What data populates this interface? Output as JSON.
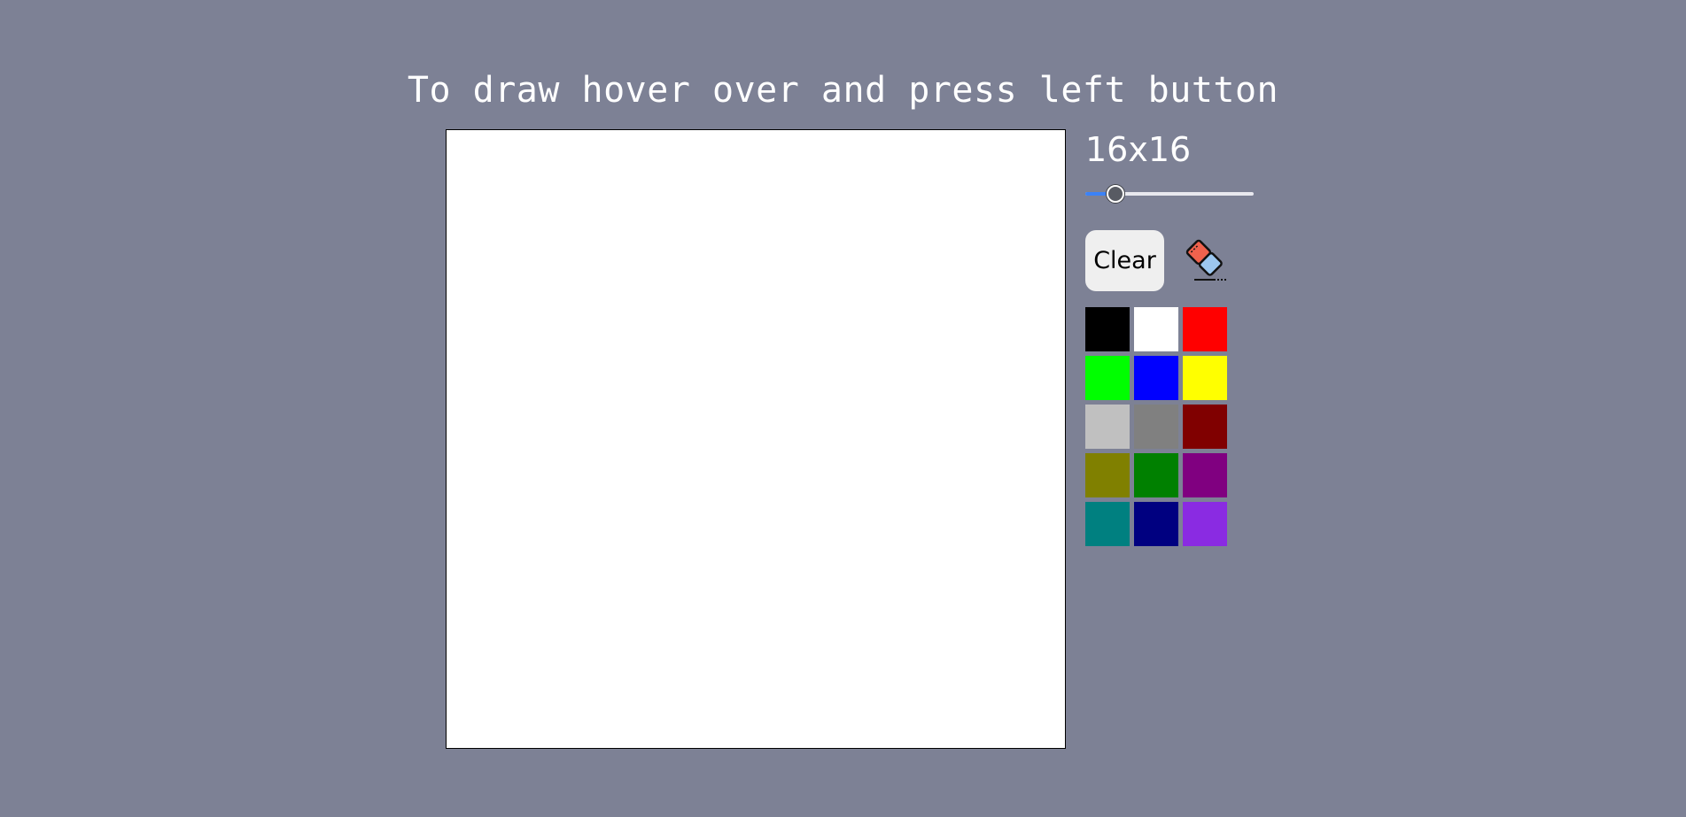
{
  "header": {
    "title": "To draw hover over and press left button"
  },
  "grid": {
    "size_label": "16x16",
    "slider_value_fraction": 0.18
  },
  "tools": {
    "clear_label": "Clear",
    "eraser_icon": "eraser-icon"
  },
  "palette": {
    "colors": [
      "#000000",
      "#ffffff",
      "#ff0000",
      "#00ff00",
      "#0000ff",
      "#ffff00",
      "#c0c0c0",
      "#808080",
      "#800000",
      "#808000",
      "#008000",
      "#800080",
      "#008080",
      "#000080",
      "#8a2be2"
    ]
  },
  "colors": {
    "background": "#7d8195",
    "canvas": "#ffffff",
    "slider_accent": "#3b82f6"
  }
}
